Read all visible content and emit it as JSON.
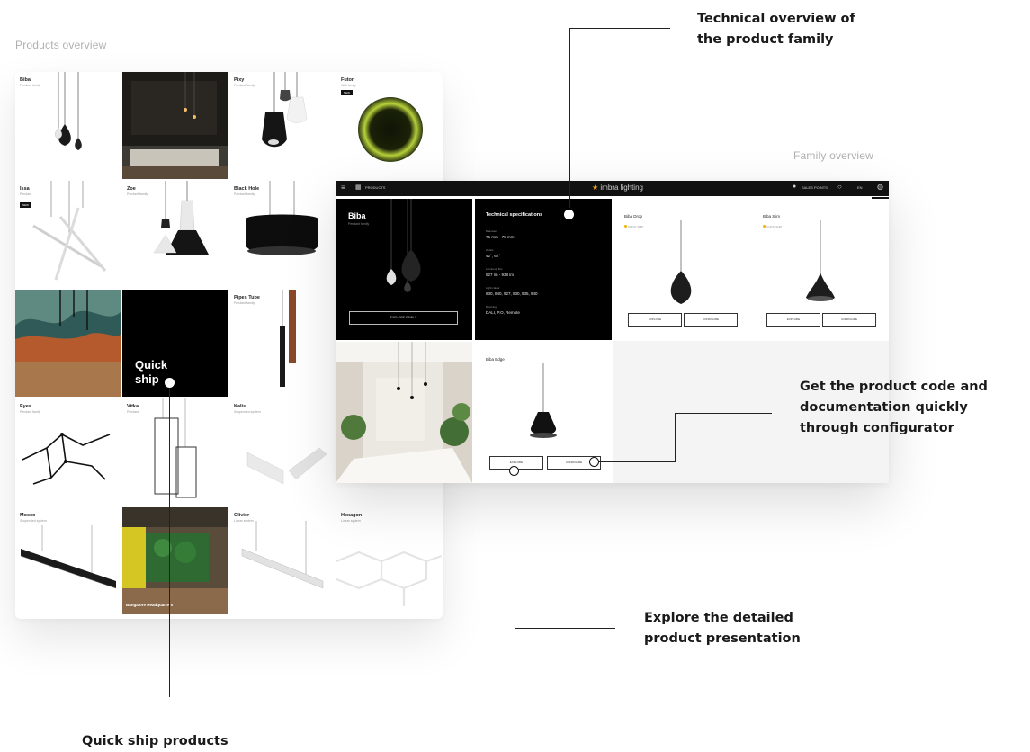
{
  "captions": {
    "products_overview": "Products overview",
    "family_overview": "Family overview"
  },
  "annotations": {
    "technical": "Technical overview of\nthe product family",
    "configurator": "Get the product code and\ndocumentation quickly\nthrough configurator",
    "explore": "Explore the detailed\nproduct presentation",
    "quick_ship": "Quick ship products"
  },
  "grid": {
    "tiles": [
      {
        "name": "Biba",
        "sub": "Pendant family"
      },
      {
        "name": "",
        "sub": ""
      },
      {
        "name": "Pixy",
        "sub": "Pendant family"
      },
      {
        "name": "Futon",
        "sub": "Wall family",
        "badge": "NEW"
      },
      {
        "name": "Issa",
        "sub": "Pendant",
        "badge": "NEW"
      },
      {
        "name": "Zoe",
        "sub": "Pendant family"
      },
      {
        "name": "Black Hole",
        "sub": "Pendant family"
      },
      {
        "name": "",
        "sub": ""
      },
      {
        "name": "",
        "sub": ""
      },
      {
        "name": "",
        "sub": ""
      },
      {
        "name": "Pipes Tube",
        "sub": "Pendant family"
      },
      {
        "name": "",
        "sub": ""
      },
      {
        "name": "Eyes",
        "sub": "Pendant family"
      },
      {
        "name": "Vitka",
        "sub": "Pendant"
      },
      {
        "name": "Kalis",
        "sub": "Suspended system"
      },
      {
        "name": "",
        "sub": ""
      },
      {
        "name": "Mosco",
        "sub": "Suspended system"
      },
      {
        "name": "",
        "sub": "",
        "caption": "Bangalore Headquarters"
      },
      {
        "name": "Olivier",
        "sub": "Linear system"
      },
      {
        "name": "Hexagon",
        "sub": "Linear system"
      }
    ],
    "quick_ship_label": "Quick\nship"
  },
  "family": {
    "nav": {
      "products": "PRODUCTS",
      "logo": "imbra lighting",
      "location": "SALES POINTS",
      "lang": "EN"
    },
    "close": "×",
    "biba": {
      "title": "Biba",
      "subtitle": "Pendant family",
      "button": "EXPLORE FAMILY"
    },
    "tech": {
      "heading": "Technical specifications",
      "rows": [
        {
          "label": "Diameter",
          "value": "75 mm - 78 mm"
        },
        {
          "label": "Optics",
          "value": "42°, 62°"
        },
        {
          "label": "Luminous flux",
          "value": "527 lm - 938 lm"
        },
        {
          "label": "Light colour",
          "value": "830, 840, 927, 930, 935, 940"
        },
        {
          "label": "Dimming",
          "value": "DALI, P.O, Remote"
        }
      ]
    },
    "products": [
      {
        "name": "Biba Drop",
        "quick_ship": "QUICK SHIP",
        "explore": "EXPLORE",
        "configure": "CONFIGURE"
      },
      {
        "name": "Biba Slim",
        "quick_ship": "QUICK SHIP",
        "explore": "EXPLORE",
        "configure": "CONFIGURE"
      },
      {
        "name": "Biba Edge",
        "quick_ship": "",
        "explore": "EXPLORE",
        "configure": "CONFIGURE"
      }
    ]
  },
  "colors": {
    "accent": "#f3a21a",
    "quick_ship_dot": "#f0b400",
    "dark": "#000000"
  }
}
